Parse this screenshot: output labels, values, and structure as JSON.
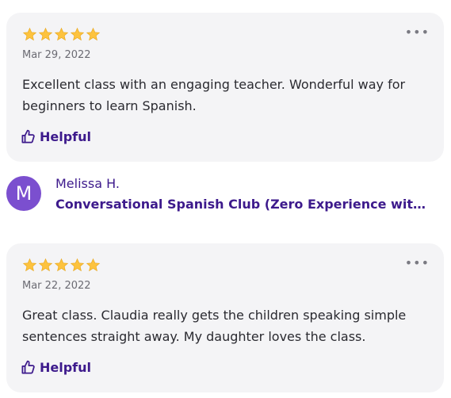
{
  "reviews": [
    {
      "rating": 5,
      "date": "Mar 29, 2022",
      "text": "Excellent class with an engaging teacher. Wonderful way for beginners to learn Spanish.",
      "helpful_label": "Helpful",
      "more_label": "•••"
    },
    {
      "rating": 5,
      "date": "Mar 22, 2022",
      "text": "Great class. Claudia really gets the children speaking simple sentences straight away. My daughter loves the class.",
      "helpful_label": "Helpful",
      "more_label": "•••"
    }
  ],
  "reviewer": {
    "initial": "M",
    "name": "Melissa H.",
    "class_title": "Conversational Spanish Club (Zero Experience with Spanish)"
  },
  "colors": {
    "star": "#fdc33e",
    "accent": "#3d1a8c",
    "avatar": "#7b4fcf",
    "card_bg": "#f4f4f6"
  },
  "icons": {
    "star": "star-icon",
    "helpful": "thumbs-up-icon",
    "more": "more-horizontal-icon"
  }
}
